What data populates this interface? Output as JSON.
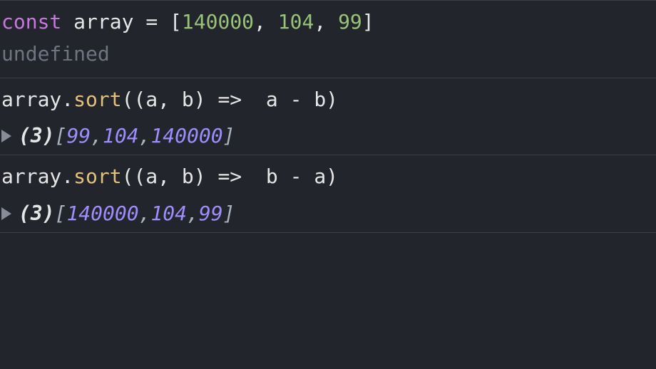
{
  "entry1": {
    "kw": "const",
    "ident": "array",
    "eq": "=",
    "open": "[",
    "v0": "140000",
    "c0": ", ",
    "v1": "104",
    "c1": ", ",
    "v2": "99",
    "close": "]",
    "result": "undefined"
  },
  "entry2": {
    "ident": "array",
    "dot": ".",
    "method": "sort",
    "args": "((a, b) =>  a - b)",
    "count": "(3)",
    "open": "[",
    "v0": "99",
    "d0": ", ",
    "v1": "104",
    "d1": ", ",
    "v2": "140000",
    "close": "]"
  },
  "entry3": {
    "ident": "array",
    "dot": ".",
    "method": "sort",
    "args": "((a, b) =>  b - a)",
    "count": "(3)",
    "open": "[",
    "v0": "140000",
    "d0": ", ",
    "v1": "104",
    "d1": ", ",
    "v2": "99",
    "close": "]"
  }
}
